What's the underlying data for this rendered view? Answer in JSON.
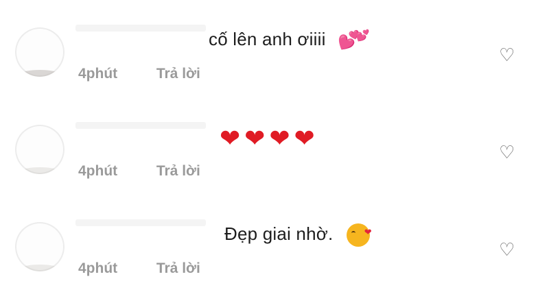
{
  "comments": [
    {
      "text": "cố lên anh ơiiii",
      "emoji": "💕💕",
      "emoji_icon": "two-hearts-icon",
      "time": "4phút",
      "reply_label": "Trả lời",
      "like_icon": "heart-outline-icon"
    },
    {
      "text": "",
      "emoji": "❤❤❤❤",
      "emoji_icon": "red-heart-icon",
      "time": "4phút",
      "reply_label": "Trả lời",
      "like_icon": "heart-outline-icon"
    },
    {
      "text": "Đẹp giai nhờ.",
      "emoji": "😘",
      "emoji_icon": "face-blowing-kiss-icon",
      "time": "4phút",
      "reply_label": "Trả lời",
      "like_icon": "heart-outline-icon"
    }
  ],
  "colors": {
    "text": "#1d1d1d",
    "meta": "#9a9a9a",
    "heart_pink": "#e5399a",
    "heart_red": "#e01b24"
  }
}
